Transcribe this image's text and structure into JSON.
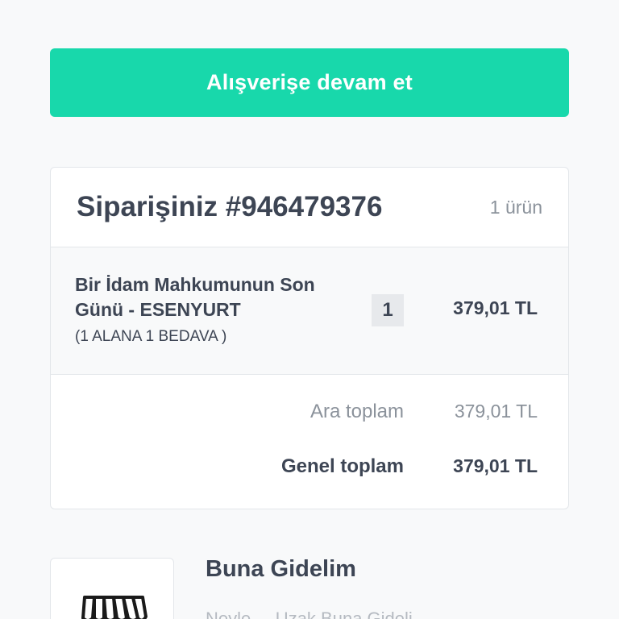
{
  "continue_button": {
    "label": "Alışverişe devam et"
  },
  "order": {
    "title": "Siparişiniz #946479376",
    "item_count": "1 ürün",
    "items": [
      {
        "name": "Bir İdam Mahkumunun Son Günü - ESENYURT",
        "subtitle": "(1 ALANA 1 BEDAVA )",
        "quantity": "1",
        "price": "379,01 TL"
      }
    ],
    "subtotal_label": "Ara toplam",
    "subtotal_value": "379,01 TL",
    "total_label": "Genel toplam",
    "total_value": "379,01 TL"
  },
  "store": {
    "name": "Buna Gidelim",
    "description": "Neyle ... Uzak Buna Gideli",
    "logo_icon": "storefront-awning-icon"
  },
  "colors": {
    "accent": "#18d8ab",
    "text": "#3d4554",
    "muted": "#8b929b"
  }
}
